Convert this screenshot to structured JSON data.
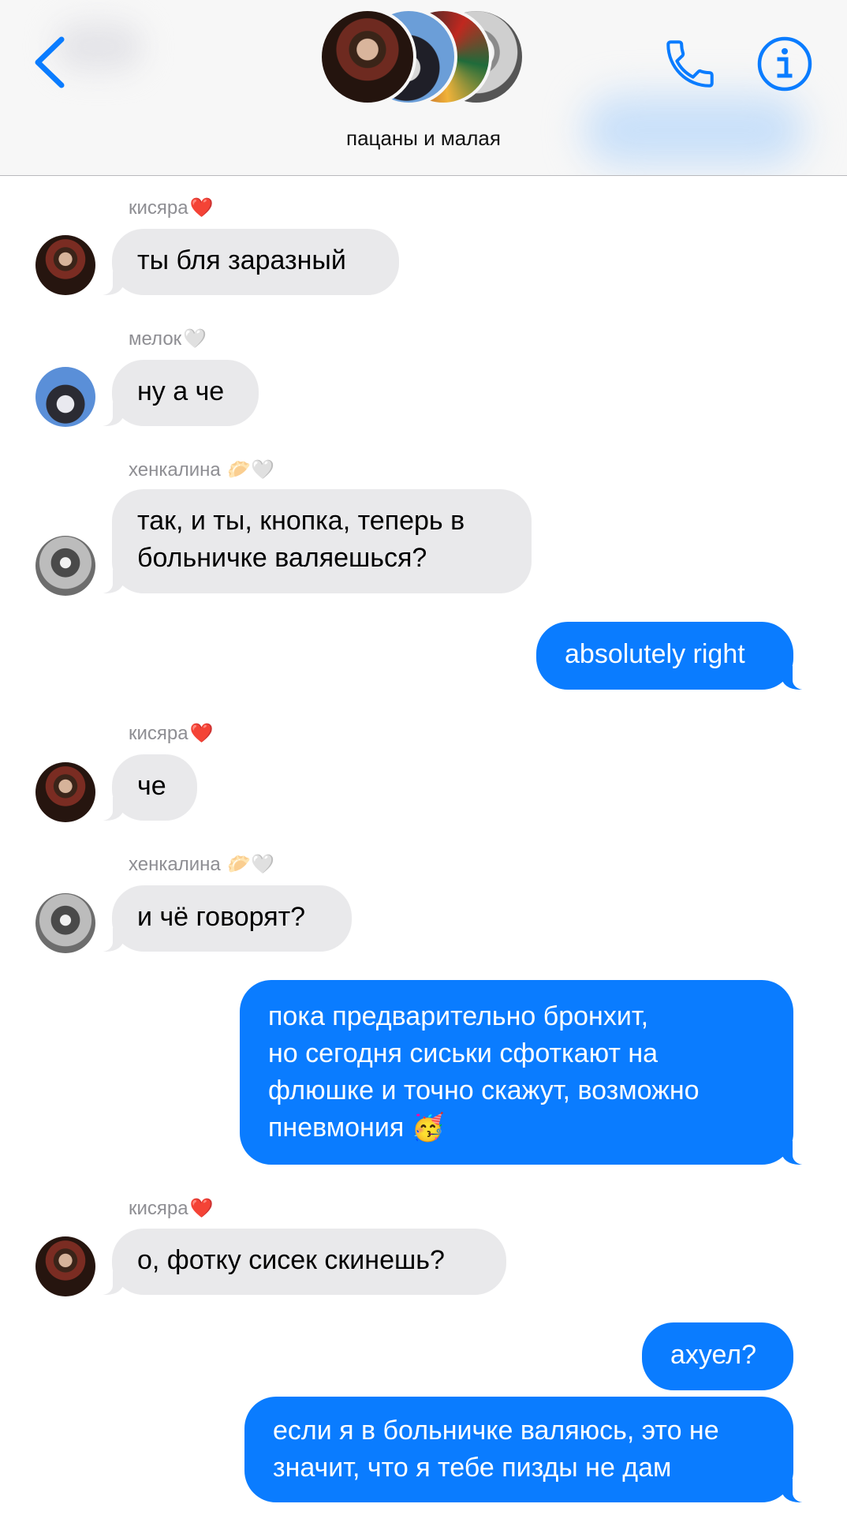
{
  "header": {
    "title": "пацаны и малая",
    "back_icon": "chevron-left-icon",
    "call_icon": "phone-icon",
    "info_icon": "info-icon",
    "accent_color": "#0a7cff"
  },
  "messages": [
    {
      "sender": "кисяра",
      "sender_emoji": "❤️",
      "text": "ты бля заразный",
      "direction": "incoming"
    },
    {
      "sender": "мелок",
      "sender_emoji": "🤍",
      "text": "ну а че",
      "direction": "incoming"
    },
    {
      "sender": "хенкалина",
      "sender_emoji": "🥟🤍",
      "line1": "так, и ты, кнопка, теперь в",
      "line2": "больничке валяешься?",
      "direction": "incoming"
    },
    {
      "text": "absolutely right",
      "direction": "outgoing"
    },
    {
      "sender": "кисяра",
      "sender_emoji": "❤️",
      "text": "че",
      "direction": "incoming"
    },
    {
      "sender": "хенкалина",
      "sender_emoji": "🥟🤍",
      "text": "и чё говорят?",
      "direction": "incoming"
    },
    {
      "line1": "пока предварительно бронхит,",
      "line2": "но сегодня сиськи сфоткают на",
      "line3": "флюшке и точно скажут, возможно",
      "line4": "пневмония 🥳",
      "direction": "outgoing"
    },
    {
      "sender": "кисяра",
      "sender_emoji": "❤️",
      "text": "о, фотку сисек скинешь?",
      "direction": "incoming"
    },
    {
      "text": "ахуел?",
      "direction": "outgoing"
    },
    {
      "line1": "если я в больничке валяюсь, это не",
      "line2": "значит, что я тебе пизды не дам",
      "direction": "outgoing"
    }
  ],
  "colors": {
    "incoming_bubble": "#e9e9eb",
    "outgoing_bubble": "#0a7cff",
    "sender_label": "#8e8e93"
  }
}
